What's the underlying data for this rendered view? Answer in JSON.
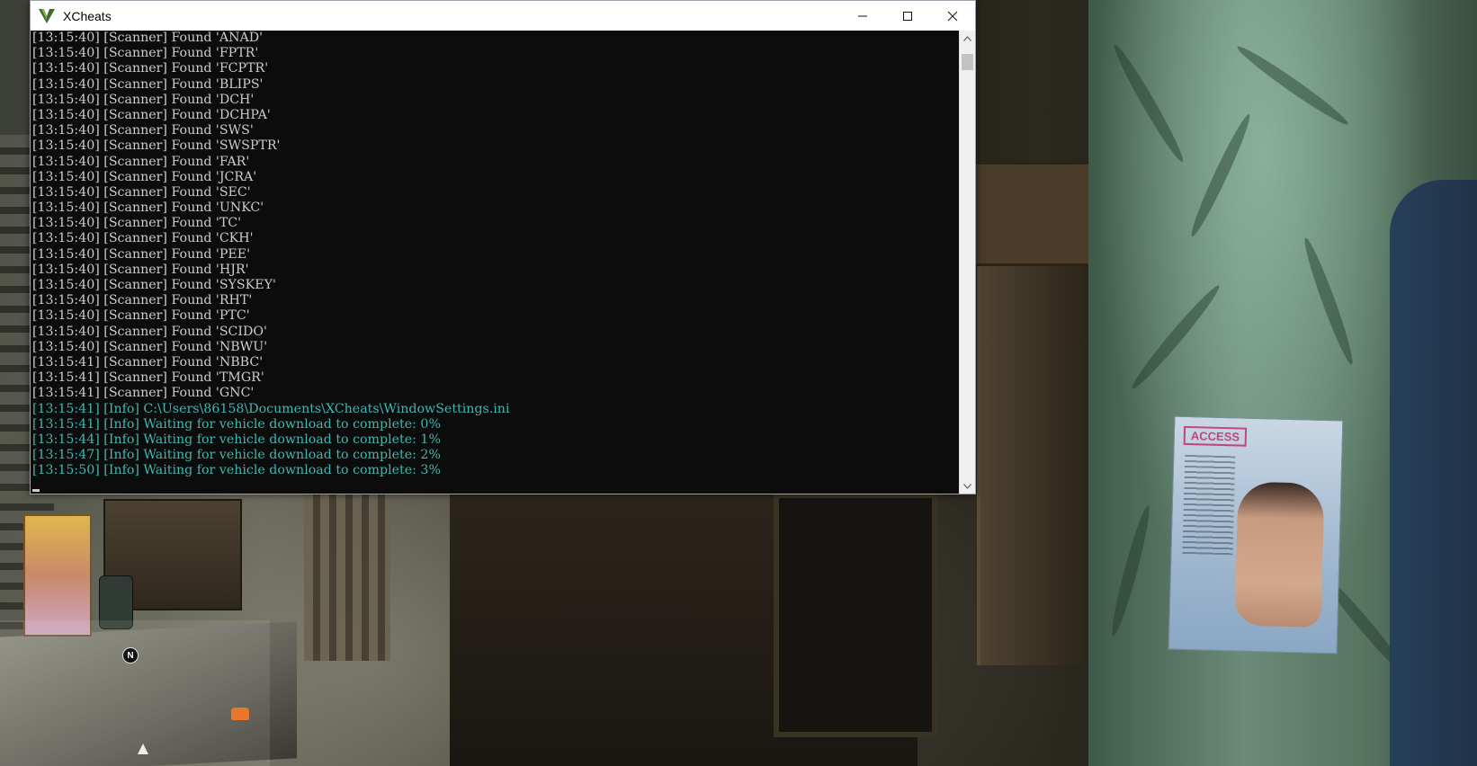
{
  "window": {
    "title": "XCheats",
    "icon": "v-logo-icon",
    "controls": {
      "minimize": "minimize-icon",
      "maximize": "maximize-icon",
      "close": "close-icon"
    }
  },
  "console": {
    "lines": [
      {
        "text": "[13:15:40] [Scanner] Found 'ANAD'",
        "type": "scanner"
      },
      {
        "text": "[13:15:40] [Scanner] Found 'FPTR'",
        "type": "scanner"
      },
      {
        "text": "[13:15:40] [Scanner] Found 'FCPTR'",
        "type": "scanner"
      },
      {
        "text": "[13:15:40] [Scanner] Found 'BLIPS'",
        "type": "scanner"
      },
      {
        "text": "[13:15:40] [Scanner] Found 'DCH'",
        "type": "scanner"
      },
      {
        "text": "[13:15:40] [Scanner] Found 'DCHPA'",
        "type": "scanner"
      },
      {
        "text": "[13:15:40] [Scanner] Found 'SWS'",
        "type": "scanner"
      },
      {
        "text": "[13:15:40] [Scanner] Found 'SWSPTR'",
        "type": "scanner"
      },
      {
        "text": "[13:15:40] [Scanner] Found 'FAR'",
        "type": "scanner"
      },
      {
        "text": "[13:15:40] [Scanner] Found 'JCRA'",
        "type": "scanner"
      },
      {
        "text": "[13:15:40] [Scanner] Found 'SEC'",
        "type": "scanner"
      },
      {
        "text": "[13:15:40] [Scanner] Found 'UNKC'",
        "type": "scanner"
      },
      {
        "text": "[13:15:40] [Scanner] Found 'TC'",
        "type": "scanner"
      },
      {
        "text": "[13:15:40] [Scanner] Found 'CKH'",
        "type": "scanner"
      },
      {
        "text": "[13:15:40] [Scanner] Found 'PEE'",
        "type": "scanner"
      },
      {
        "text": "[13:15:40] [Scanner] Found 'HJR'",
        "type": "scanner"
      },
      {
        "text": "[13:15:40] [Scanner] Found 'SYSKEY'",
        "type": "scanner"
      },
      {
        "text": "[13:15:40] [Scanner] Found 'RHT'",
        "type": "scanner"
      },
      {
        "text": "[13:15:40] [Scanner] Found 'PTC'",
        "type": "scanner"
      },
      {
        "text": "[13:15:40] [Scanner] Found 'SCIDO'",
        "type": "scanner"
      },
      {
        "text": "[13:15:40] [Scanner] Found 'NBWU'",
        "type": "scanner"
      },
      {
        "text": "[13:15:41] [Scanner] Found 'NBBC'",
        "type": "scanner"
      },
      {
        "text": "[13:15:41] [Scanner] Found 'TMGR'",
        "type": "scanner"
      },
      {
        "text": "[13:15:41] [Scanner] Found 'GNC'",
        "type": "scanner"
      },
      {
        "text": "[13:15:41] [Info] C:\\Users\\86158\\Documents\\XCheats\\WindowSettings.ini",
        "type": "info"
      },
      {
        "text": "[13:15:41] [Info] Waiting for vehicle download to complete: 0%",
        "type": "info"
      },
      {
        "text": "[13:15:44] [Info] Waiting for vehicle download to complete: 1%",
        "type": "info"
      },
      {
        "text": "[13:15:47] [Info] Waiting for vehicle download to complete: 2%",
        "type": "info"
      },
      {
        "text": "[13:15:50] [Info] Waiting for vehicle download to complete: 3%",
        "type": "info"
      }
    ],
    "colors": {
      "background": "#0c0c0c",
      "text": "#cccccc",
      "info": "#3fb8b0"
    }
  },
  "scrollbar": {
    "up_icon": "arrow-up-icon",
    "down_icon": "arrow-down-icon"
  },
  "game": {
    "poster_title": "ACCESS",
    "compass_label": "N",
    "blip_icons": [
      "vehicle-blip-icon",
      "player-arrow-icon"
    ]
  }
}
